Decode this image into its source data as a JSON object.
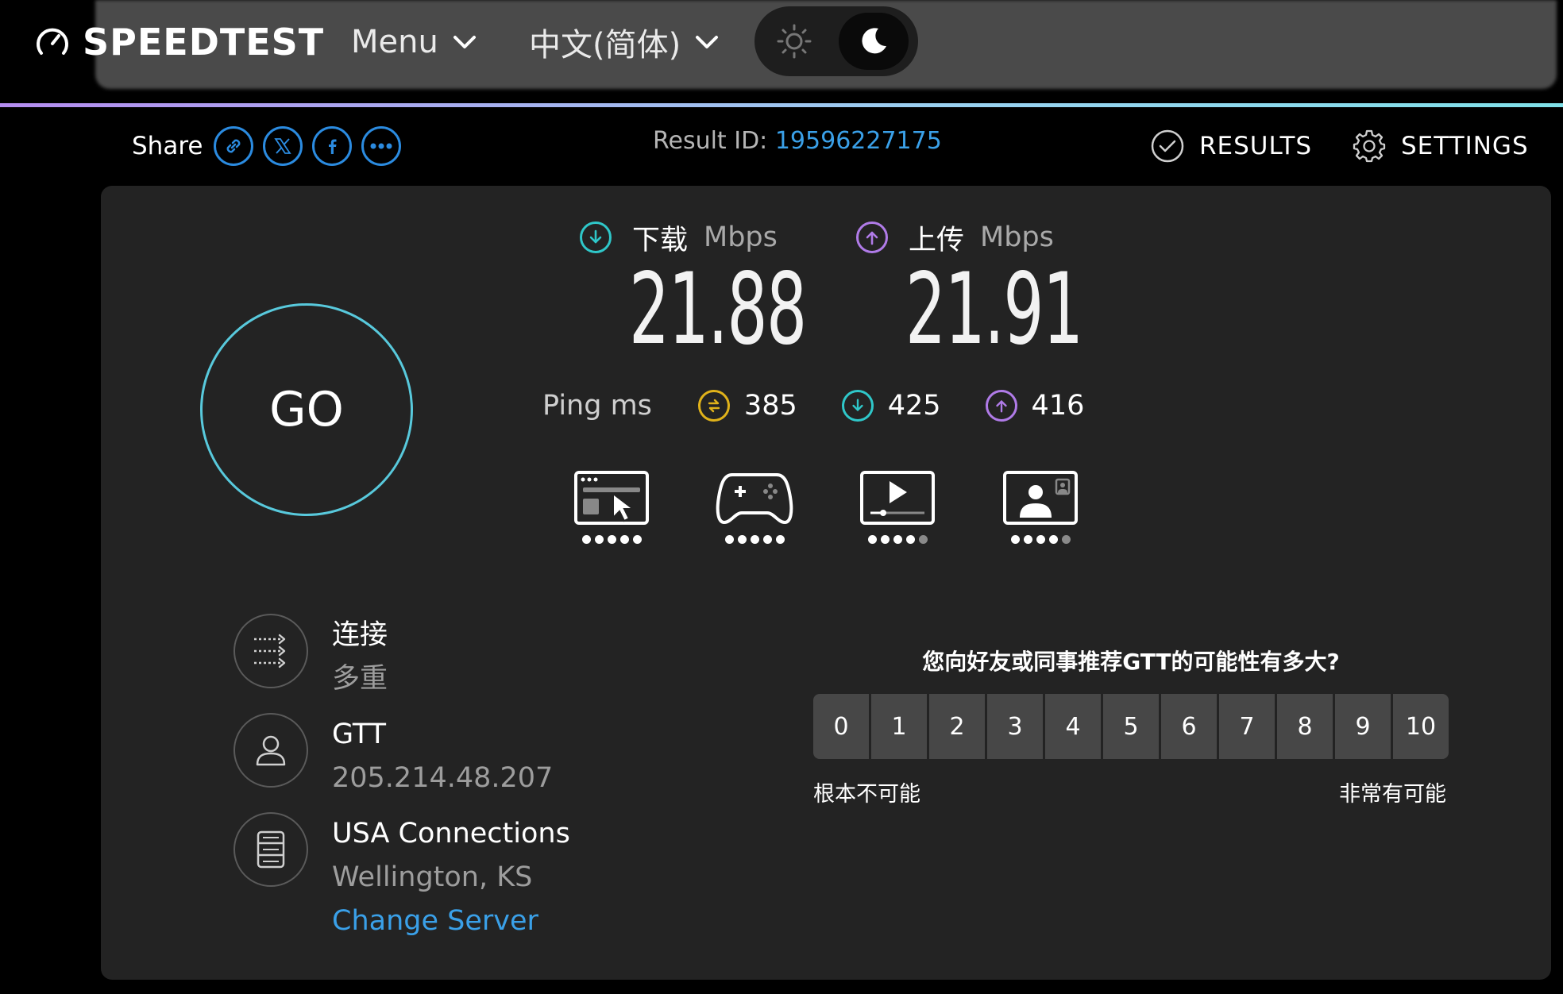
{
  "header": {
    "logo_text": "SPEEDTEST",
    "menu_label": "Menu",
    "language_label": "中文(简体)",
    "theme": {
      "light_icon": "sun-icon",
      "dark_icon": "moon-icon",
      "active": "dark"
    }
  },
  "share": {
    "label": "Share",
    "buttons": [
      {
        "icon": "link-icon"
      },
      {
        "icon": "x-logo-icon"
      },
      {
        "icon": "facebook-icon"
      },
      {
        "icon": "more-icon"
      }
    ]
  },
  "result": {
    "label": "Result ID:",
    "id": "19596227175"
  },
  "actions": {
    "results_label": "RESULTS",
    "settings_label": "SETTINGS"
  },
  "go_label": "GO",
  "download": {
    "label": "下载",
    "unit": "Mbps",
    "value": "21.88"
  },
  "upload": {
    "label": "上传",
    "unit": "Mbps",
    "value": "21.91"
  },
  "ping": {
    "label": "Ping ms",
    "idle": "385",
    "download": "425",
    "upload": "416"
  },
  "quality_ratings": [
    {
      "icon": "browsing-icon",
      "rating": 5,
      "max": 5
    },
    {
      "icon": "gaming-icon",
      "rating": 5,
      "max": 5
    },
    {
      "icon": "streaming-icon",
      "rating": 4,
      "max": 5
    },
    {
      "icon": "video-call-icon",
      "rating": 4,
      "max": 5
    }
  ],
  "connection": {
    "label": "连接",
    "value": "多重"
  },
  "provider": {
    "name": "GTT",
    "ip": "205.214.48.207"
  },
  "server": {
    "name": "USA Connections",
    "location": "Wellington, KS",
    "change_label": "Change Server"
  },
  "nps": {
    "question": "您向好友或同事推荐GTT的可能性有多大?",
    "options": [
      "0",
      "1",
      "2",
      "3",
      "4",
      "5",
      "6",
      "7",
      "8",
      "9",
      "10"
    ],
    "low_label": "根本不可能",
    "high_label": "非常有可能"
  },
  "colors": {
    "accent_blue": "#3aa0e8",
    "download_teal": "#2fc7c9",
    "upload_purple": "#b07be8",
    "ping_yellow": "#e0b21a"
  }
}
